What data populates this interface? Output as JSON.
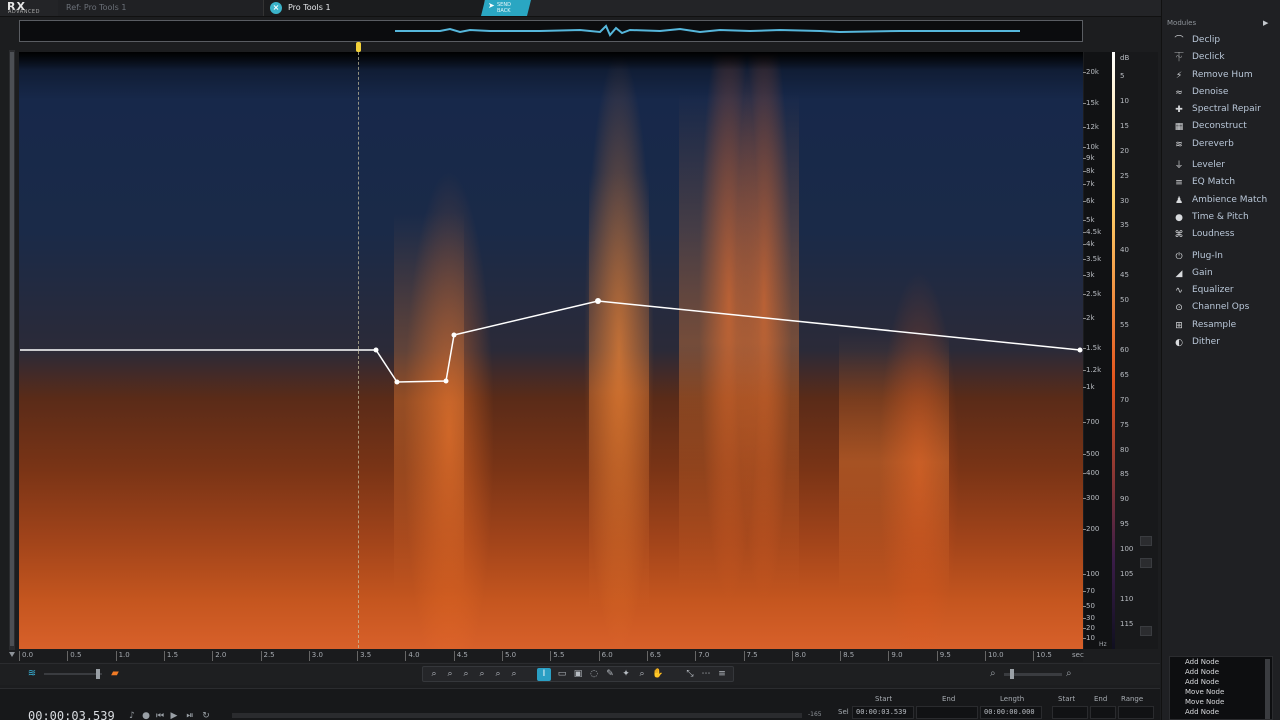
{
  "app": {
    "logo_text": "RX",
    "logo_sub": "ADVANCED",
    "brand": "iZotope"
  },
  "tabs": [
    {
      "label": "Ref: Pro Tools 1",
      "active": false
    },
    {
      "label": "Pro Tools 1",
      "active": true
    }
  ],
  "send_back": {
    "line1": "SEND",
    "line2": "BACK"
  },
  "frequency_axis": {
    "unit": "Hz",
    "labels": [
      "20k",
      "15k",
      "12k",
      "10k",
      "9k",
      "8k",
      "7k",
      "6k",
      "5k",
      "4.5k",
      "4k",
      "3.5k",
      "3k",
      "2.5k",
      "2k",
      "1.5k",
      "1.2k",
      "1k",
      "700",
      "500",
      "400",
      "300",
      "200",
      "100",
      "70",
      "50",
      "30",
      "20",
      "10"
    ]
  },
  "db_axis": {
    "unit": "dB",
    "labels": [
      "5",
      "10",
      "15",
      "20",
      "25",
      "30",
      "35",
      "40",
      "45",
      "50",
      "55",
      "60",
      "65",
      "70",
      "75",
      "80",
      "85",
      "90",
      "95",
      "100",
      "105",
      "110",
      "115"
    ]
  },
  "time_axis": {
    "unit": "sec",
    "labels": [
      "0.0",
      "0.5",
      "1.0",
      "1.5",
      "2.0",
      "2.5",
      "3.0",
      "3.5",
      "4.0",
      "4.5",
      "5.0",
      "5.5",
      "6.0",
      "6.5",
      "7.0",
      "7.5",
      "8.0",
      "8.5",
      "9.0",
      "9.5",
      "10.0",
      "10.5"
    ]
  },
  "colors": {
    "accent": "#2aa6c2",
    "curve": "#ffffff",
    "marker": "#f3d23a",
    "spectro_hot": "#f07a25"
  },
  "modules": {
    "header": "Modules",
    "groups": [
      [
        {
          "label": "Declip",
          "icon": "declip-icon",
          "glyph": "⌒"
        },
        {
          "label": "Declick",
          "icon": "declick-icon",
          "glyph": "⏇"
        },
        {
          "label": "Remove Hum",
          "icon": "remove-hum-icon",
          "glyph": "⚡"
        },
        {
          "label": "Denoise",
          "icon": "denoise-icon",
          "glyph": "≈"
        },
        {
          "label": "Spectral Repair",
          "icon": "spectral-repair-icon",
          "glyph": "✚"
        },
        {
          "label": "Deconstruct",
          "icon": "deconstruct-icon",
          "glyph": "▦"
        },
        {
          "label": "Dereverb",
          "icon": "dereverb-icon",
          "glyph": "≋"
        }
      ],
      [
        {
          "label": "Leveler",
          "icon": "leveler-icon",
          "glyph": "⏚"
        },
        {
          "label": "EQ Match",
          "icon": "eq-match-icon",
          "glyph": "≡"
        },
        {
          "label": "Ambience Match",
          "icon": "ambience-match-icon",
          "glyph": "♟"
        },
        {
          "label": "Time & Pitch",
          "icon": "time-pitch-icon",
          "glyph": "●"
        },
        {
          "label": "Loudness",
          "icon": "loudness-icon",
          "glyph": "⌘"
        }
      ],
      [
        {
          "label": "Plug-In",
          "icon": "plug-in-icon",
          "glyph": "⏻"
        },
        {
          "label": "Gain",
          "icon": "gain-icon",
          "glyph": "◢"
        },
        {
          "label": "Equalizer",
          "icon": "equalizer-icon",
          "glyph": "∿"
        },
        {
          "label": "Channel Ops",
          "icon": "channel-ops-icon",
          "glyph": "⊙"
        },
        {
          "label": "Resample",
          "icon": "resample-icon",
          "glyph": "⊞"
        },
        {
          "label": "Dither",
          "icon": "dither-icon",
          "glyph": "◐"
        }
      ]
    ]
  },
  "history": [
    "Add Node",
    "Add Node",
    "Add Node",
    "Move Node",
    "Move Node",
    "Add Node"
  ],
  "transport": {
    "timecode": "00:00:03.539",
    "progress_value": "-165"
  },
  "selection": {
    "headers": [
      "Start",
      "End",
      "Length",
      "Start",
      "End",
      "Range"
    ],
    "row_label": "Sel",
    "start": "00:00:03.539",
    "end": "",
    "length": "00:00:00.000"
  }
}
